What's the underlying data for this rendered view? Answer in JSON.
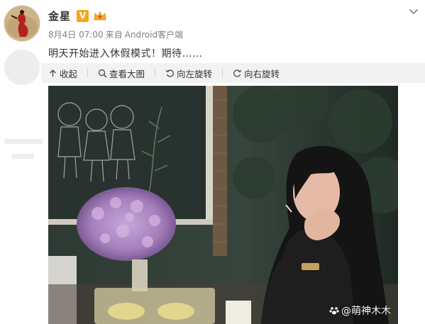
{
  "post": {
    "author": "金星",
    "verified_badge": "V",
    "date": "8月4日 07:00",
    "source_prefix": "来自",
    "source": "Android客户端",
    "text": "明天开始进入休假模式！期待……"
  },
  "toolbar": {
    "collapse": "收起",
    "view_large": "查看大图",
    "rotate_left": "向左旋转",
    "rotate_right": "向右旋转"
  },
  "photo": {
    "watermark": "@萌神木木"
  },
  "colors": {
    "badge": "#f5a623",
    "toolbar_bg": "#f2f2f2"
  },
  "icons": [
    "chevron-down-icon",
    "collapse-icon",
    "magnifier-icon",
    "rotate-left-icon",
    "rotate-right-icon",
    "crown-icon"
  ]
}
